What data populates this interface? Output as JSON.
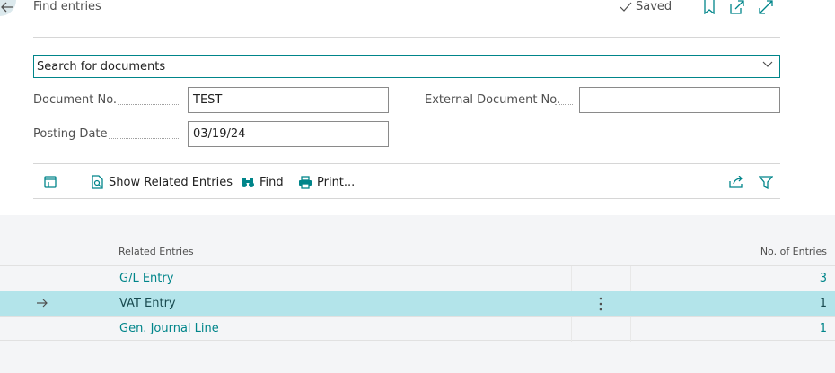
{
  "header": {
    "title": "Find entries",
    "saved_label": "Saved",
    "icons": [
      "back-arrow-icon",
      "checkmark-icon",
      "bookmark-icon",
      "open-in-new-window-icon",
      "expand-icon"
    ]
  },
  "search": {
    "value": "Search for documents"
  },
  "fields": {
    "document_no_label": "Document No.",
    "document_no_value": "TEST",
    "external_document_no_label": "External Document No.",
    "external_document_no_value": "",
    "posting_date_label": "Posting Date",
    "posting_date_value": "03/19/24"
  },
  "toolbar": {
    "show_related_label": "Show Related Entries",
    "find_label": "Find",
    "print_label": "Print..."
  },
  "list": {
    "col_related": "Related Entries",
    "col_count": "No. of Entries",
    "rows": [
      {
        "name": "G/L Entry",
        "count": "3",
        "selected": false
      },
      {
        "name": "VAT Entry",
        "count": "1",
        "selected": true
      },
      {
        "name": "Gen. Journal Line",
        "count": "1",
        "selected": false
      }
    ]
  },
  "colors": {
    "accent": "#00858a",
    "selected_row": "#b3e4ea",
    "list_background": "#f4f5f7"
  }
}
